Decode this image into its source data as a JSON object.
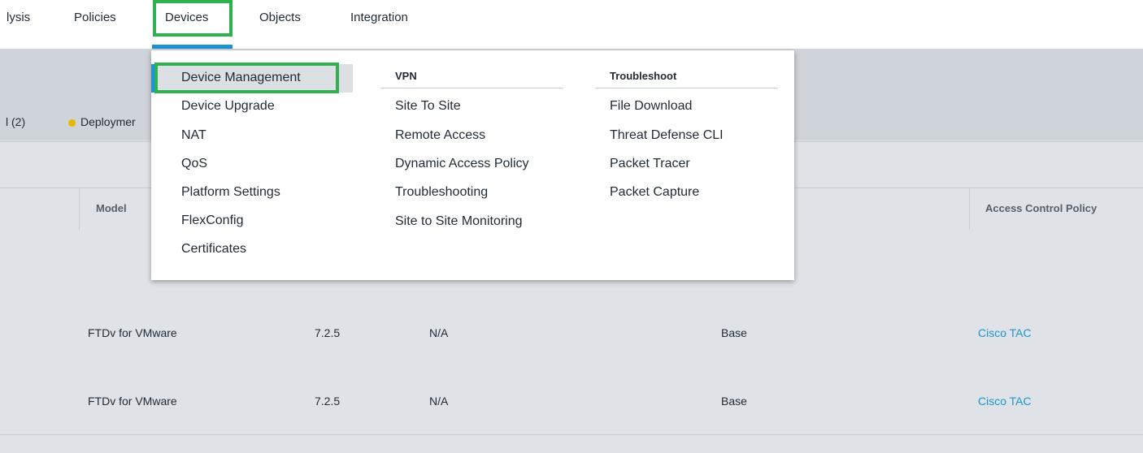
{
  "topnav": {
    "items": [
      {
        "label": "lysis"
      },
      {
        "label": "Policies"
      },
      {
        "label": "Devices"
      },
      {
        "label": "Objects"
      },
      {
        "label": "Integration"
      }
    ],
    "active": "Devices"
  },
  "band": {
    "count_text": "l (2)",
    "status_text": "Deploymer"
  },
  "table": {
    "headers": {
      "model": "Model",
      "acp": "Access Control Policy"
    },
    "rows": [
      {
        "model": "FTDv for VMware",
        "version": "7.2.5",
        "chassis": "N/A",
        "licenses": "Base",
        "acp": "Cisco TAC"
      },
      {
        "model": "FTDv for VMware",
        "version": "7.2.5",
        "chassis": "N/A",
        "licenses": "Base",
        "acp": "Cisco TAC"
      }
    ]
  },
  "dropdown": {
    "col1": [
      "Device Management",
      "Device Upgrade",
      "NAT",
      "QoS",
      "Platform Settings",
      "FlexConfig",
      "Certificates"
    ],
    "vpn": {
      "heading": "VPN",
      "items": [
        "Site To Site",
        "Remote Access",
        "Dynamic Access Policy",
        "Troubleshooting",
        "Site to Site Monitoring"
      ]
    },
    "troubleshoot": {
      "heading": "Troubleshoot",
      "items": [
        "File Download",
        "Threat Defense CLI",
        "Packet Tracer",
        "Packet Capture"
      ]
    },
    "highlighted": "Device Management"
  },
  "colors": {
    "accent": "#1d93d0",
    "highlight_box": "#2fb14e",
    "status_dot": "#e6b800"
  }
}
